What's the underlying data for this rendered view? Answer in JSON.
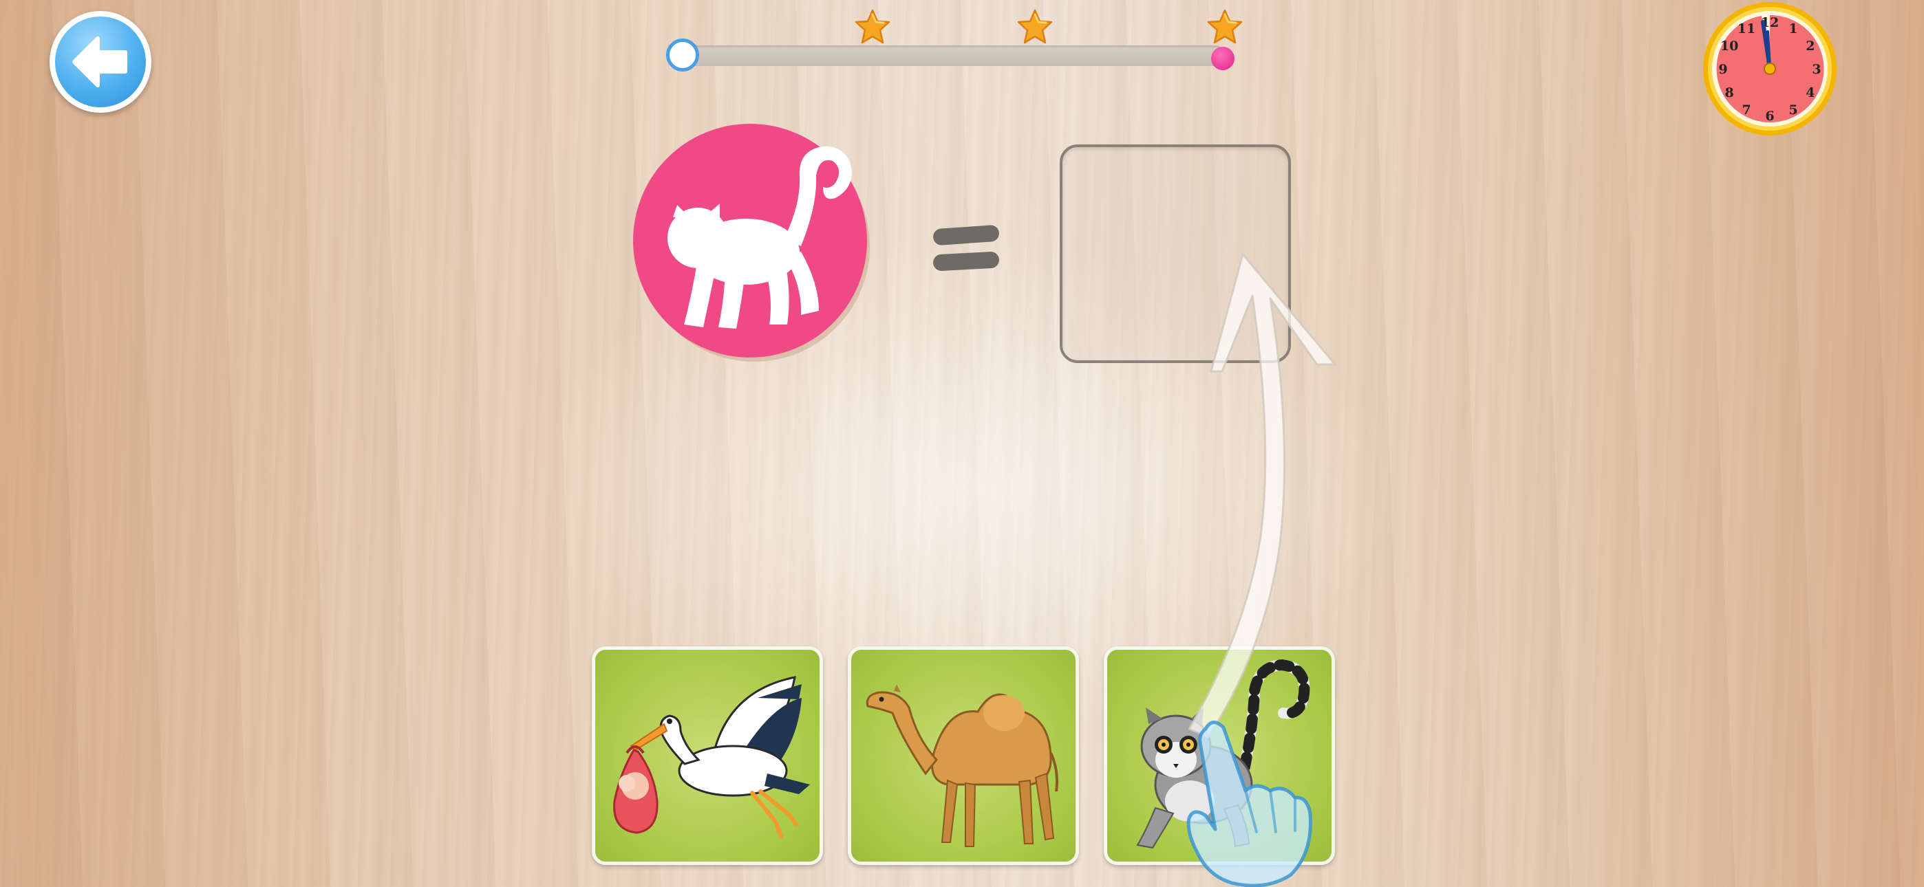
{
  "game": {
    "type": "shape-silhouette matching",
    "target_silhouette": "lemur-silhouette",
    "target_color": "#ef4a86"
  },
  "back_button": {
    "icon": "arrow-left-icon"
  },
  "progress": {
    "fill_fraction": 0.0,
    "stars": [
      {
        "icon": "star-icon",
        "color": "#f5a623"
      },
      {
        "icon": "star-icon",
        "color": "#f5a623"
      },
      {
        "icon": "star-icon",
        "color": "#f5a623"
      }
    ],
    "start_marker_color": "#4aa0e8",
    "end_marker_color": "#e0208a"
  },
  "clock": {
    "face_color": "#f46f72",
    "rim_color": "#f5c518",
    "hour_numbers": [
      "12",
      "1",
      "2",
      "3",
      "4",
      "5",
      "6",
      "7",
      "8",
      "9",
      "10",
      "11"
    ]
  },
  "choices": [
    {
      "name": "stork",
      "icon": "stork-carrying-baby-icon"
    },
    {
      "name": "camel",
      "icon": "camel-icon"
    },
    {
      "name": "lemur",
      "icon": "lemur-icon"
    }
  ],
  "hint": {
    "arrow_icon": "curved-arrow-up-icon",
    "hand_icon": "pointing-hand-icon"
  },
  "colors": {
    "card_green": "#a9c948",
    "card_border": "#f4f7ea",
    "slot_border": "#8c8178"
  }
}
